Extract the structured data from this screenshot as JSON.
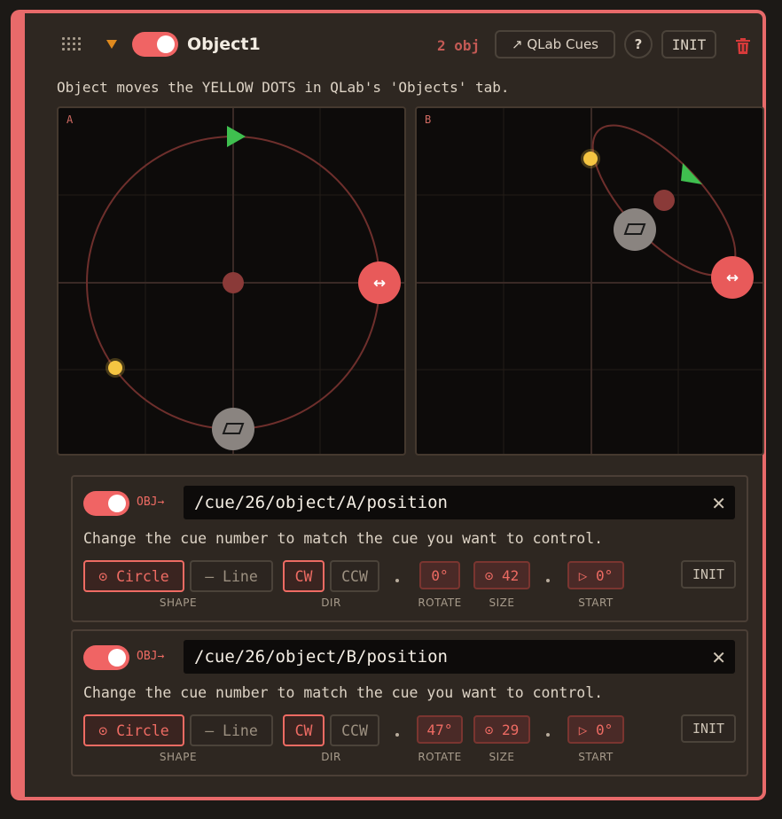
{
  "header": {
    "object_name": "Object1",
    "object_count": "2 obj",
    "qlab_cues_label": "↗ QLab Cues",
    "help_label": "?",
    "init_label": "INIT"
  },
  "description": "Object moves the YELLOW DOTS in QLab's 'Objects' tab.",
  "pads": [
    {
      "label": "A",
      "rotate_icon": "↔"
    },
    {
      "label": "B",
      "rotate_icon": "↔"
    }
  ],
  "layers": [
    {
      "enabled": true,
      "obj_label": "OBJ→",
      "address": "/cue/26/object/A/position",
      "clear_icon": "✕",
      "hint": "Change the cue number to match the cue you want to control.",
      "shape_options": [
        "⊙ Circle",
        "— Line"
      ],
      "shape_selected": "⊙ Circle",
      "dir_options": [
        "CW",
        "CCW"
      ],
      "dir_selected": "CW",
      "rotate": "0°",
      "size": "⊙ 42",
      "start": "▷ 0°",
      "init_label": "INIT",
      "captions": {
        "shape": "SHAPE",
        "dir": "DIR",
        "rotate": "ROTATE",
        "size": "SIZE",
        "start": "START"
      }
    },
    {
      "enabled": true,
      "obj_label": "OBJ→",
      "address": "/cue/26/object/B/position",
      "clear_icon": "✕",
      "hint": "Change the cue number to match the cue you want to control.",
      "shape_options": [
        "⊙ Circle",
        "— Line"
      ],
      "shape_selected": "⊙ Circle",
      "dir_options": [
        "CW",
        "CCW"
      ],
      "dir_selected": "CW",
      "rotate": "47°",
      "size": "⊙ 29",
      "start": "▷ 0°",
      "init_label": "INIT",
      "captions": {
        "shape": "SHAPE",
        "dir": "DIR",
        "rotate": "ROTATE",
        "size": "SIZE",
        "start": "START"
      }
    }
  ],
  "colors": {
    "accent": "#f06464",
    "border": "#e86a6a",
    "yellow_dot": "#f5c542",
    "direction_arrow": "#3fbf4f",
    "panel_bg": "#2e2721"
  }
}
